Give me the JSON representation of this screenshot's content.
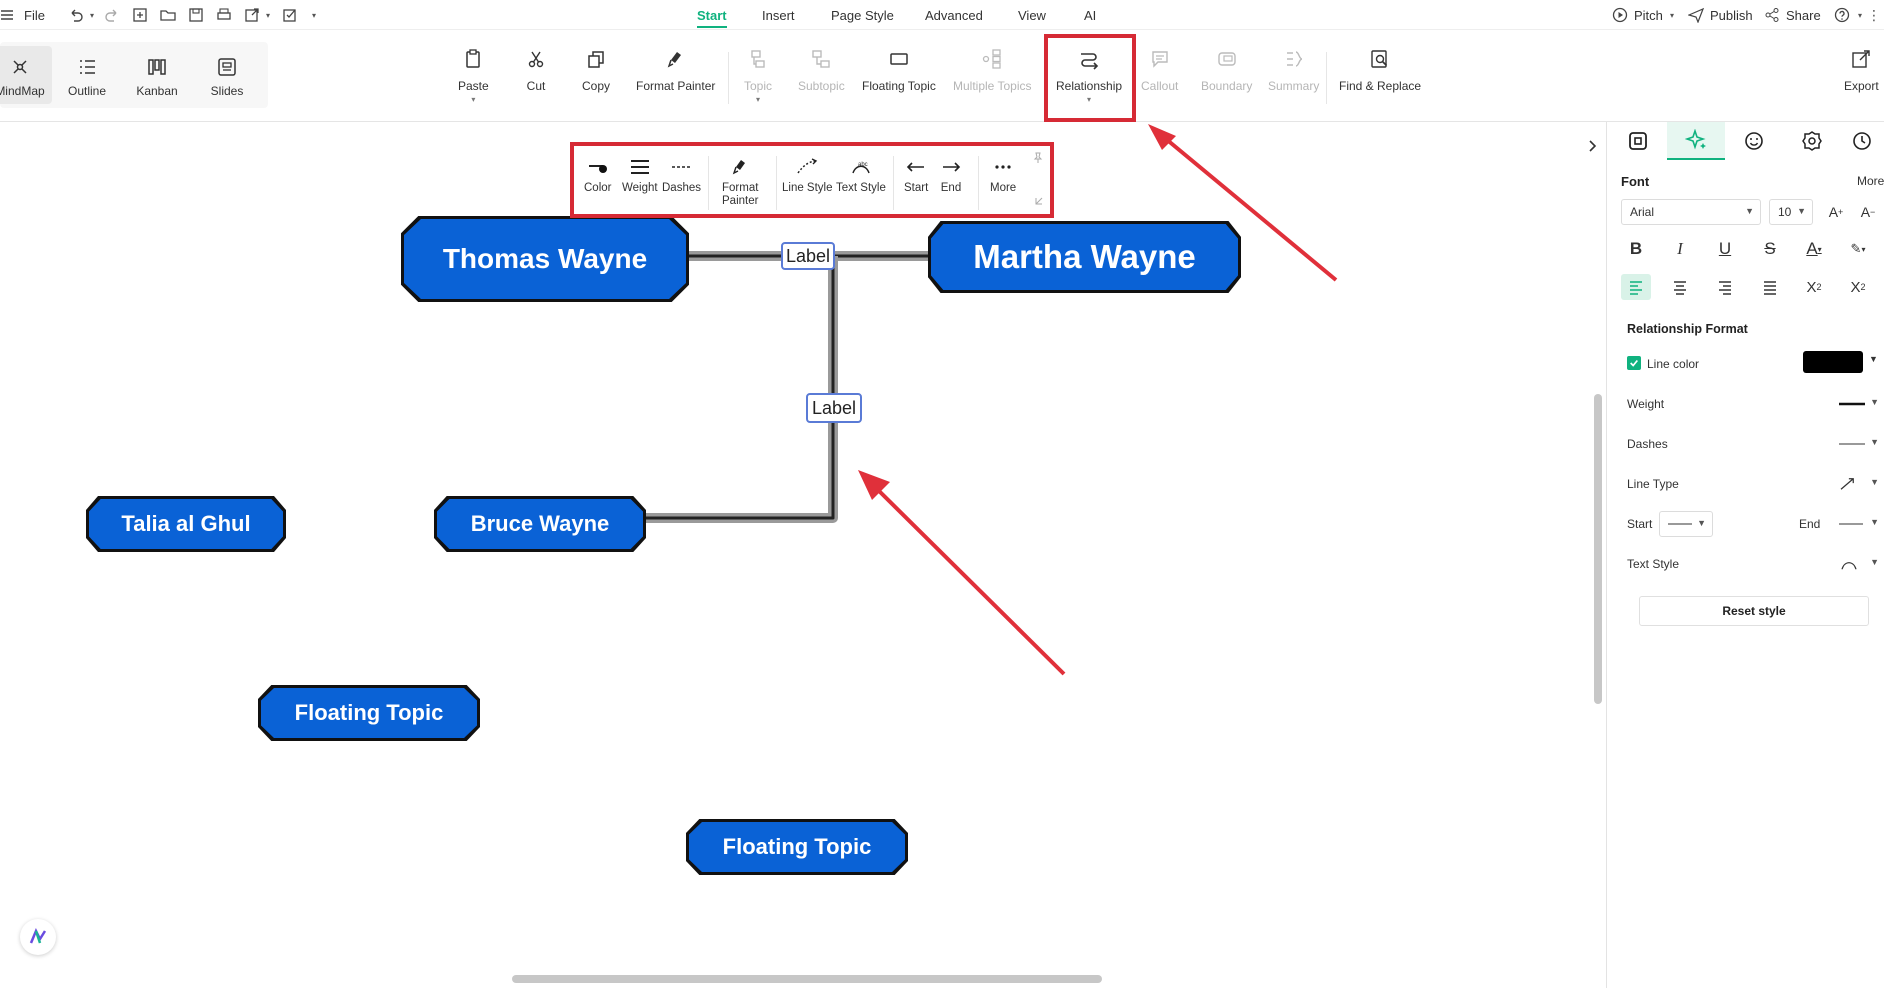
{
  "menubar": {
    "file": "File",
    "tabs": [
      "Start",
      "Insert",
      "Page Style",
      "Advanced",
      "View",
      "AI"
    ],
    "right": {
      "pitch": "Pitch",
      "publish": "Publish",
      "share": "Share"
    }
  },
  "ribbon": {
    "views": [
      "MindMap",
      "Outline",
      "Kanban",
      "Slides"
    ],
    "paste": "Paste",
    "cut": "Cut",
    "copy": "Copy",
    "format_painter": "Format Painter",
    "topic": "Topic",
    "subtopic": "Subtopic",
    "floating_topic": "Floating Topic",
    "multiple_topics": "Multiple Topics",
    "relationship": "Relationship",
    "callout": "Callout",
    "boundary": "Boundary",
    "summary": "Summary",
    "find_replace": "Find & Replace",
    "export": "Export"
  },
  "minitoolbar": {
    "color": "Color",
    "weight": "Weight",
    "dashes": "Dashes",
    "format_painter_1": "Format",
    "format_painter_2": "Painter",
    "line_style": "Line Style",
    "text_style": "Text Style",
    "start": "Start",
    "end": "End",
    "more": "More"
  },
  "canvas": {
    "nodes": {
      "thomas": "Thomas Wayne",
      "martha": "Martha Wayne",
      "bruce": "Bruce Wayne",
      "talia": "Talia al Ghul",
      "floating1": "Floating Topic",
      "floating2": "Floating Topic"
    },
    "labels": {
      "top": "Label",
      "mid": "Label"
    }
  },
  "panel": {
    "font_title": "Font",
    "more": "More",
    "font_family": "Arial",
    "font_size": "10",
    "section_title": "Relationship Format",
    "line_color": "Line color",
    "line_color_value": "#000000",
    "weight": "Weight",
    "dashes": "Dashes",
    "line_type": "Line Type",
    "start": "Start",
    "end": "End",
    "text_style": "Text Style",
    "reset": "Reset style"
  },
  "colors": {
    "accent": "#10b27f",
    "node_fill": "#0a62d6",
    "highlight": "#d62a35"
  }
}
